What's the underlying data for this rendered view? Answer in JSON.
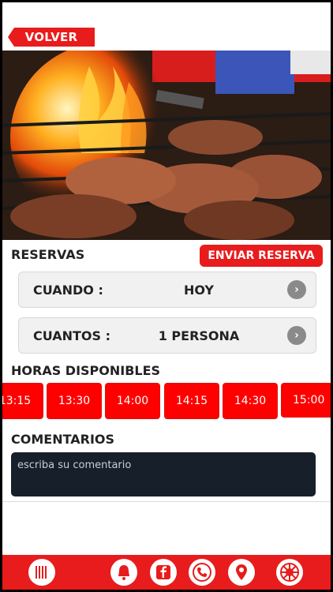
{
  "header": {
    "back_label": "VOLVER"
  },
  "reservas": {
    "title": "RESERVAS",
    "send_label": "ENVIAR RESERVA",
    "when_label": "CUANDO :",
    "when_value": "HOY",
    "count_label": "CUANTOS :",
    "count_value": "1 PERSONA"
  },
  "hours": {
    "title": "HORAS DISPONIBLES",
    "slots": [
      "13:15",
      "13:30",
      "14:00",
      "14:15",
      "14:30",
      "15:00"
    ]
  },
  "comments": {
    "title": "COMENTARIOS",
    "placeholder": "escriba su comentario"
  },
  "bottom_nav": [
    "menu-icon",
    "bell-icon",
    "facebook-icon",
    "phone-icon",
    "location-icon",
    "wheel-icon"
  ],
  "colors": {
    "accent": "#e81c1c",
    "slot": "#ff0000",
    "comment_bg": "#17202a"
  }
}
